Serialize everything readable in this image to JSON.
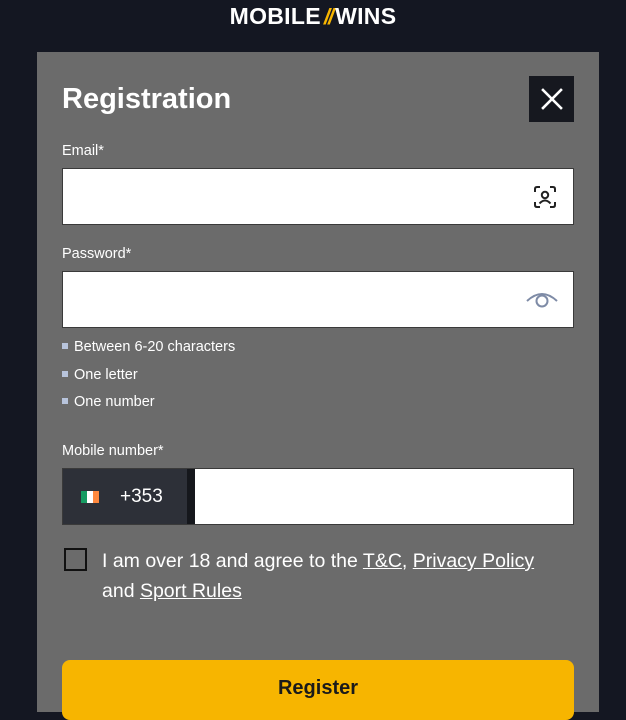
{
  "brand": {
    "left": "MOBILE",
    "slashes": "//",
    "right": "WINS"
  },
  "modal": {
    "title": "Registration"
  },
  "email": {
    "label": "Email*",
    "value": "",
    "placeholder": ""
  },
  "password": {
    "label": "Password*",
    "value": "",
    "placeholder": ""
  },
  "password_rules": [
    "Between 6-20 characters",
    "One letter",
    "One number"
  ],
  "mobile": {
    "label": "Mobile number*",
    "country_code": "+353",
    "flag": "ireland",
    "value": ""
  },
  "consent": {
    "checked": false,
    "text_before": "I am over 18 and agree to the ",
    "tc_link": "T&C",
    "comma": ",",
    "privacy_link": "Privacy Policy",
    "and_text": " and ",
    "sport_rules_link": "Sport Rules"
  },
  "register": {
    "label": "Register"
  },
  "icons": {
    "close": "close-icon",
    "email_autofill": "contact-scan-icon",
    "password_toggle": "eye-icon"
  },
  "colors": {
    "background": "#141722",
    "modal": "#6b6b6b",
    "accent": "#f7b500",
    "dark_button": "#16181f"
  }
}
